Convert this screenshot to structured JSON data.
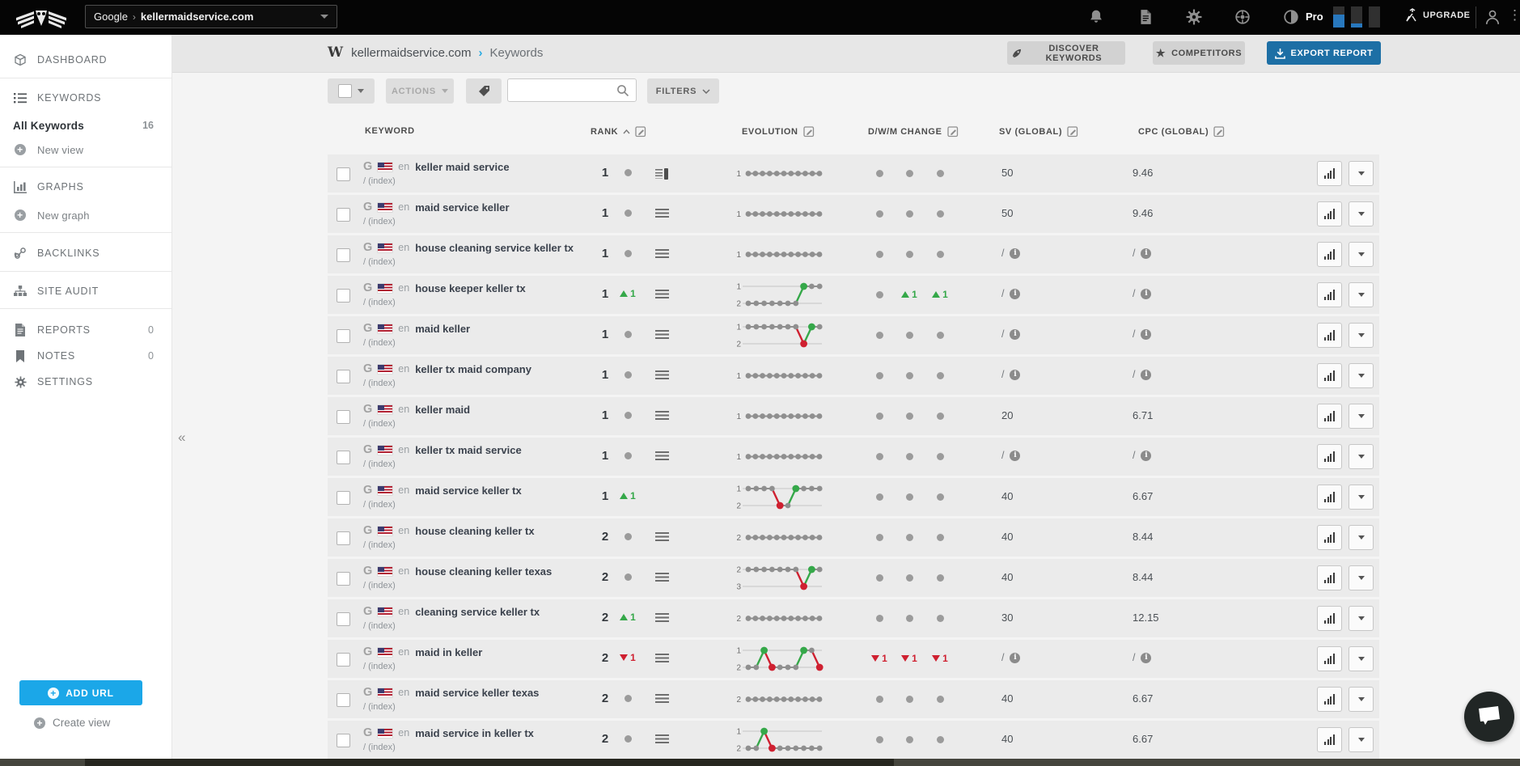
{
  "topbar": {
    "scope": "Google",
    "scope_sep": "›",
    "domain": "kellermaidservice.com",
    "plan": "Pro",
    "upgrade_label": "UPGRADE",
    "usage_meters": [
      0.6,
      0.18,
      0
    ]
  },
  "sidebar": {
    "dashboard": "DASHBOARD",
    "keywords": "KEYWORDS",
    "all_keywords": "All Keywords",
    "all_keywords_count": "16",
    "new_view": "New view",
    "graphs": "GRAPHS",
    "new_graph": "New graph",
    "backlinks": "BACKLINKS",
    "site_audit": "SITE AUDIT",
    "reports": "REPORTS",
    "reports_count": "0",
    "notes": "NOTES",
    "notes_count": "0",
    "settings": "SETTINGS",
    "collapse_glyph": "«",
    "add_url": "ADD URL",
    "create_view": "Create view"
  },
  "header": {
    "favicon_glyph": "W",
    "site": "kellermaidservice.com",
    "crumb_sep": "›",
    "section": "Keywords",
    "discover": "DISCOVER KEYWORDS",
    "competitors": "COMPETITORS",
    "export": "EXPORT REPORT",
    "star_glyph": "★"
  },
  "toolbar": {
    "actions": "ACTIONS",
    "filters": "FILTERS",
    "search_placeholder": ""
  },
  "table": {
    "headers": {
      "keyword": "KEYWORD",
      "rank": "RANK",
      "evolution": "EVOLUTION",
      "dwm": "D/W/M CHANGE",
      "sv": "SV (GLOBAL)",
      "cpc": "CPC (GLOBAL)"
    },
    "rows": [
      {
        "keyword": "keller maid service",
        "locale": "en",
        "url": "/ (index)",
        "rank": "1",
        "rank_change": {
          "dir": "none"
        },
        "serp": "list-block",
        "evolution": [
          1,
          1,
          1,
          1,
          1,
          1,
          1,
          1,
          1,
          1,
          1
        ],
        "dwm": [
          {
            "dir": "none"
          },
          {
            "dir": "none"
          },
          {
            "dir": "none"
          }
        ],
        "sv": "50",
        "cpc": "9.46"
      },
      {
        "keyword": "maid service keller",
        "locale": "en",
        "url": "/ (index)",
        "rank": "1",
        "rank_change": {
          "dir": "none"
        },
        "serp": "list",
        "evolution": [
          1,
          1,
          1,
          1,
          1,
          1,
          1,
          1,
          1,
          1,
          1
        ],
        "dwm": [
          {
            "dir": "none"
          },
          {
            "dir": "none"
          },
          {
            "dir": "none"
          }
        ],
        "sv": "50",
        "cpc": "9.46"
      },
      {
        "keyword": "house cleaning service keller tx",
        "locale": "en",
        "url": "/ (index)",
        "rank": "1",
        "rank_change": {
          "dir": "none"
        },
        "serp": "list",
        "evolution": [
          1,
          1,
          1,
          1,
          1,
          1,
          1,
          1,
          1,
          1,
          1
        ],
        "dwm": [
          {
            "dir": "none"
          },
          {
            "dir": "none"
          },
          {
            "dir": "none"
          }
        ],
        "sv": null,
        "cpc": null
      },
      {
        "keyword": "house keeper keller tx",
        "locale": "en",
        "url": "/ (index)",
        "rank": "1",
        "rank_change": {
          "dir": "up",
          "value": "1"
        },
        "serp": "list",
        "evolution": [
          2,
          2,
          2,
          2,
          2,
          2,
          2,
          1,
          1,
          1
        ],
        "dwm": [
          {
            "dir": "none"
          },
          {
            "dir": "up",
            "value": "1"
          },
          {
            "dir": "up",
            "value": "1"
          }
        ],
        "sv": null,
        "cpc": null
      },
      {
        "keyword": "maid keller",
        "locale": "en",
        "url": "/ (index)",
        "rank": "1",
        "rank_change": {
          "dir": "none"
        },
        "serp": "list",
        "evolution": [
          1,
          1,
          1,
          1,
          1,
          1,
          1,
          2,
          1,
          1
        ],
        "dwm": [
          {
            "dir": "none"
          },
          {
            "dir": "none"
          },
          {
            "dir": "none"
          }
        ],
        "sv": null,
        "cpc": null
      },
      {
        "keyword": "keller tx maid company",
        "locale": "en",
        "url": "/ (index)",
        "rank": "1",
        "rank_change": {
          "dir": "none"
        },
        "serp": "list",
        "evolution": [
          1,
          1,
          1,
          1,
          1,
          1,
          1,
          1,
          1,
          1,
          1
        ],
        "dwm": [
          {
            "dir": "none"
          },
          {
            "dir": "none"
          },
          {
            "dir": "none"
          }
        ],
        "sv": null,
        "cpc": null
      },
      {
        "keyword": "keller maid",
        "locale": "en",
        "url": "/ (index)",
        "rank": "1",
        "rank_change": {
          "dir": "none"
        },
        "serp": "list",
        "evolution": [
          1,
          1,
          1,
          1,
          1,
          1,
          1,
          1,
          1,
          1,
          1
        ],
        "dwm": [
          {
            "dir": "none"
          },
          {
            "dir": "none"
          },
          {
            "dir": "none"
          }
        ],
        "sv": "20",
        "cpc": "6.71"
      },
      {
        "keyword": "keller tx maid service",
        "locale": "en",
        "url": "/ (index)",
        "rank": "1",
        "rank_change": {
          "dir": "none"
        },
        "serp": "list",
        "evolution": [
          1,
          1,
          1,
          1,
          1,
          1,
          1,
          1,
          1,
          1,
          1
        ],
        "dwm": [
          {
            "dir": "none"
          },
          {
            "dir": "none"
          },
          {
            "dir": "none"
          }
        ],
        "sv": null,
        "cpc": null
      },
      {
        "keyword": "maid service keller tx",
        "locale": "en",
        "url": "/ (index)",
        "rank": "1",
        "rank_change": {
          "dir": "up",
          "value": "1"
        },
        "serp": "none",
        "evolution": [
          1,
          1,
          1,
          1,
          2,
          2,
          1,
          1,
          1,
          1
        ],
        "dwm": [
          {
            "dir": "none"
          },
          {
            "dir": "none"
          },
          {
            "dir": "none"
          }
        ],
        "sv": "40",
        "cpc": "6.67"
      },
      {
        "keyword": "house cleaning keller tx",
        "locale": "en",
        "url": "/ (index)",
        "rank": "2",
        "rank_change": {
          "dir": "none"
        },
        "serp": "list",
        "evolution": [
          2,
          2,
          2,
          2,
          2,
          2,
          2,
          2,
          2,
          2,
          2
        ],
        "dwm": [
          {
            "dir": "none"
          },
          {
            "dir": "none"
          },
          {
            "dir": "none"
          }
        ],
        "sv": "40",
        "cpc": "8.44"
      },
      {
        "keyword": "house cleaning keller texas",
        "locale": "en",
        "url": "/ (index)",
        "rank": "2",
        "rank_change": {
          "dir": "none"
        },
        "serp": "list",
        "evolution": [
          2,
          2,
          2,
          2,
          2,
          2,
          2,
          3,
          2,
          2
        ],
        "dwm": [
          {
            "dir": "none"
          },
          {
            "dir": "none"
          },
          {
            "dir": "none"
          }
        ],
        "sv": "40",
        "cpc": "8.44"
      },
      {
        "keyword": "cleaning service keller tx",
        "locale": "en",
        "url": "/ (index)",
        "rank": "2",
        "rank_change": {
          "dir": "up",
          "value": "1"
        },
        "serp": "list",
        "evolution": [
          2,
          2,
          2,
          2,
          2,
          2,
          2,
          2,
          2,
          2,
          2
        ],
        "dwm": [
          {
            "dir": "none"
          },
          {
            "dir": "none"
          },
          {
            "dir": "none"
          }
        ],
        "sv": "30",
        "cpc": "12.15"
      },
      {
        "keyword": "maid in keller",
        "locale": "en",
        "url": "/ (index)",
        "rank": "2",
        "rank_change": {
          "dir": "down",
          "value": "1"
        },
        "serp": "list",
        "evolution": [
          2,
          2,
          1,
          2,
          2,
          2,
          2,
          1,
          1,
          2
        ],
        "dwm": [
          {
            "dir": "down",
            "value": "1"
          },
          {
            "dir": "down",
            "value": "1"
          },
          {
            "dir": "down",
            "value": "1"
          }
        ],
        "sv": null,
        "cpc": null
      },
      {
        "keyword": "maid service keller texas",
        "locale": "en",
        "url": "/ (index)",
        "rank": "2",
        "rank_change": {
          "dir": "none"
        },
        "serp": "list",
        "evolution": [
          2,
          2,
          2,
          2,
          2,
          2,
          2,
          2,
          2,
          2,
          2
        ],
        "dwm": [
          {
            "dir": "none"
          },
          {
            "dir": "none"
          },
          {
            "dir": "none"
          }
        ],
        "sv": "40",
        "cpc": "6.67"
      },
      {
        "keyword": "maid service in keller tx",
        "locale": "en",
        "url": "/ (index)",
        "rank": "2",
        "rank_change": {
          "dir": "none"
        },
        "serp": "list",
        "evolution": [
          2,
          2,
          1,
          2,
          2,
          2,
          2,
          2,
          2,
          2
        ],
        "dwm": [
          {
            "dir": "none"
          },
          {
            "dir": "none"
          },
          {
            "dir": "none"
          }
        ],
        "sv": "40",
        "cpc": "6.67"
      }
    ]
  },
  "colors": {
    "green": "#35a849",
    "red": "#cf2030",
    "gray_dot": "#8f8f8f",
    "accent_blue": "#29abe2",
    "add_url_blue": "#1ba7e8",
    "export_blue": "#1d6fa5"
  }
}
